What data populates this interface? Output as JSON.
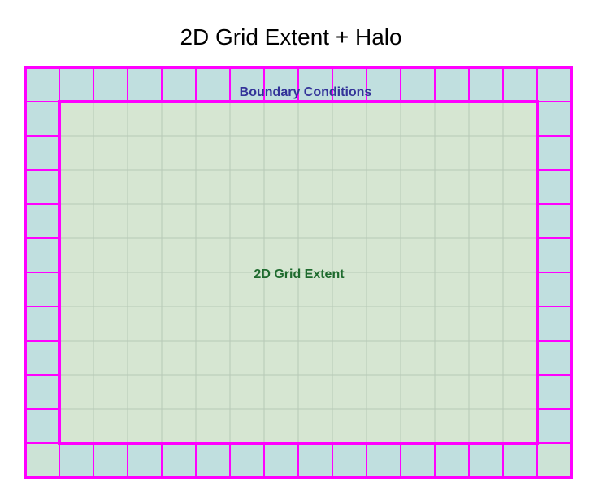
{
  "title": "2D Grid Extent + Halo",
  "labels": {
    "boundary": "Boundary Conditions",
    "extent": "2D Grid Extent"
  },
  "grid": {
    "columns": 16,
    "rows": 12,
    "halo_width": 1
  },
  "colors": {
    "halo_fill": "#c0dfdf",
    "corner_fill": "#cce3d6",
    "interior_fill": "#d6e6d2",
    "border": "#ff00ff",
    "interior_gridline": "#b7c9b7",
    "boundary_text": "#333399",
    "extent_text": "#1e6b2e"
  }
}
